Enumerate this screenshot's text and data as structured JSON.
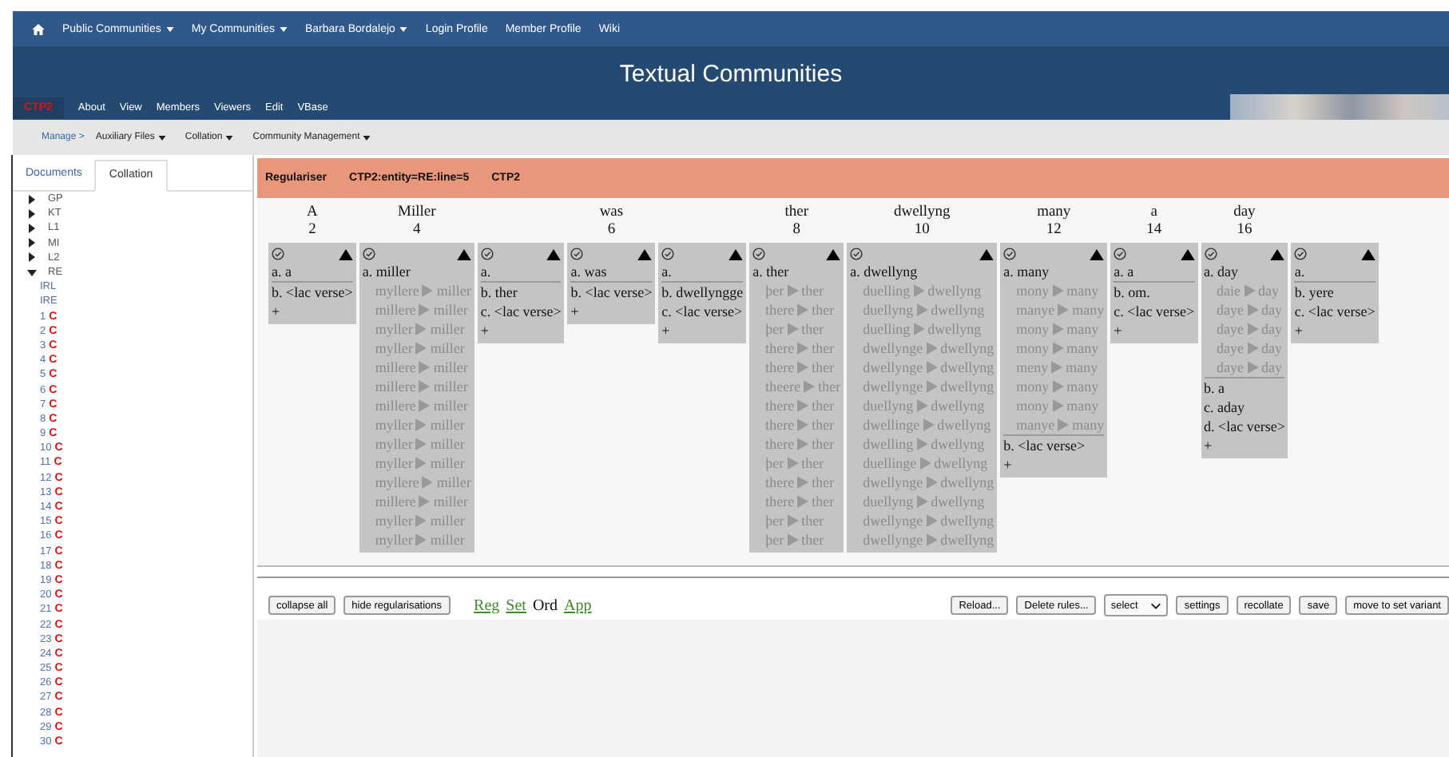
{
  "top_nav": {
    "items": [
      {
        "label": "Public Communities",
        "dropdown": true
      },
      {
        "label": "My Communities",
        "dropdown": true
      },
      {
        "label": "Barbara Bordalejo",
        "dropdown": true
      },
      {
        "label": "Login Profile",
        "dropdown": false
      },
      {
        "label": "Member Profile",
        "dropdown": false
      },
      {
        "label": "Wiki",
        "dropdown": false
      }
    ]
  },
  "header": {
    "title": "Textual Communities",
    "brand": "CTP2",
    "links": [
      "About",
      "View",
      "Members",
      "Viewers",
      "Edit",
      "VBase"
    ]
  },
  "manage_bar": {
    "label": "Manage >",
    "menus": [
      "Auxiliary Files",
      "Collation",
      "Community Management"
    ]
  },
  "sidebar": {
    "tabs": [
      {
        "label": "Documents",
        "selected": false
      },
      {
        "label": "Collation",
        "selected": true
      }
    ],
    "tree": [
      {
        "label": "GP",
        "expanded": false
      },
      {
        "label": "KT",
        "expanded": false
      },
      {
        "label": "L1",
        "expanded": false
      },
      {
        "label": "MI",
        "expanded": false
      },
      {
        "label": "L2",
        "expanded": false
      },
      {
        "label": "RE",
        "expanded": true,
        "children": [
          {
            "label": "IRL"
          },
          {
            "label": "IRE"
          },
          {
            "label": "1",
            "badge": "C"
          },
          {
            "label": "2",
            "badge": "C"
          },
          {
            "label": "3",
            "badge": "C"
          },
          {
            "label": "4",
            "badge": "C"
          },
          {
            "label": "5",
            "badge": "C"
          },
          {
            "label": "6",
            "badge": "C"
          },
          {
            "label": "7",
            "badge": "C"
          },
          {
            "label": "8",
            "badge": "C"
          },
          {
            "label": "9",
            "badge": "C"
          },
          {
            "label": "10",
            "badge": "C"
          },
          {
            "label": "11",
            "badge": "C"
          },
          {
            "label": "12",
            "badge": "C"
          },
          {
            "label": "13",
            "badge": "C"
          },
          {
            "label": "14",
            "badge": "C"
          },
          {
            "label": "15",
            "badge": "C"
          },
          {
            "label": "16",
            "badge": "C"
          },
          {
            "label": "17",
            "badge": "C"
          },
          {
            "label": "18",
            "badge": "C"
          },
          {
            "label": "19",
            "badge": "C"
          },
          {
            "label": "20",
            "badge": "C"
          },
          {
            "label": "21",
            "badge": "C"
          },
          {
            "label": "22",
            "badge": "C"
          },
          {
            "label": "23",
            "badge": "C"
          },
          {
            "label": "24",
            "badge": "C"
          },
          {
            "label": "25",
            "badge": "C"
          },
          {
            "label": "26",
            "badge": "C"
          },
          {
            "label": "27",
            "badge": "C"
          },
          {
            "label": "28",
            "badge": "C"
          },
          {
            "label": "29",
            "badge": "C"
          },
          {
            "label": "30",
            "badge": "C"
          }
        ]
      }
    ]
  },
  "regulariser": {
    "title": "Regulariser",
    "entity": "CTP2:entity=RE:line=5",
    "community": "CTP2",
    "columns": [
      {
        "word": "A",
        "number": "2",
        "variants": [
          {
            "label": "a. a"
          },
          {
            "label": "b. <lac verse>"
          }
        ],
        "add": "+"
      },
      {
        "word": "Miller",
        "number": "4",
        "variants": [
          {
            "label": "a. miller",
            "regularisations": [
              {
                "from": "myllere",
                "to": "miller"
              },
              {
                "from": "millere",
                "to": "miller"
              },
              {
                "from": "myller",
                "to": "miller"
              },
              {
                "from": "myller",
                "to": "miller"
              },
              {
                "from": "millere",
                "to": "miller"
              },
              {
                "from": "millere",
                "to": "miller"
              },
              {
                "from": "millere",
                "to": "miller"
              },
              {
                "from": "myller",
                "to": "miller"
              },
              {
                "from": "myller",
                "to": "miller"
              },
              {
                "from": "myller",
                "to": "miller"
              },
              {
                "from": "myllere",
                "to": "miller"
              },
              {
                "from": "millere",
                "to": "miller"
              },
              {
                "from": "myller",
                "to": "miller"
              },
              {
                "from": "myller",
                "to": "miller"
              }
            ]
          }
        ]
      },
      {
        "variants": [
          {
            "label": "a."
          },
          {
            "label": "b. ther"
          },
          {
            "label": "c. <lac verse>"
          }
        ],
        "add": "+"
      },
      {
        "word": "was",
        "number": "6",
        "variants": [
          {
            "label": "a. was"
          },
          {
            "label": "b. <lac verse>"
          }
        ],
        "add": "+"
      },
      {
        "variants": [
          {
            "label": "a."
          },
          {
            "label": "b. dwellyngge"
          },
          {
            "label": "c. <lac verse>"
          }
        ],
        "add": "+"
      },
      {
        "word": "ther",
        "number": "8",
        "variants": [
          {
            "label": "a. ther",
            "regularisations": [
              {
                "from": "þer",
                "to": "ther"
              },
              {
                "from": "there",
                "to": "ther"
              },
              {
                "from": "þer",
                "to": "ther"
              },
              {
                "from": "there",
                "to": "ther"
              },
              {
                "from": "there",
                "to": "ther"
              },
              {
                "from": "theere",
                "to": "ther"
              },
              {
                "from": "there",
                "to": "ther"
              },
              {
                "from": "there",
                "to": "ther"
              },
              {
                "from": "there",
                "to": "ther"
              },
              {
                "from": "þer",
                "to": "ther"
              },
              {
                "from": "there",
                "to": "ther"
              },
              {
                "from": "there",
                "to": "ther"
              },
              {
                "from": "þer",
                "to": "ther"
              },
              {
                "from": "þer",
                "to": "ther"
              }
            ]
          }
        ]
      },
      {
        "word": "dwellyng",
        "number": "10",
        "variants": [
          {
            "label": "a. dwellyng",
            "regularisations": [
              {
                "from": "duelling",
                "to": "dwellyng"
              },
              {
                "from": "duellyng",
                "to": "dwellyng"
              },
              {
                "from": "duelling",
                "to": "dwellyng"
              },
              {
                "from": "dwellynge",
                "to": "dwellyng"
              },
              {
                "from": "dwellynge",
                "to": "dwellyng"
              },
              {
                "from": "dwellynge",
                "to": "dwellyng"
              },
              {
                "from": "duellyng",
                "to": "dwellyng"
              },
              {
                "from": "dwellinge",
                "to": "dwellyng"
              },
              {
                "from": "dwelling",
                "to": "dwellyng"
              },
              {
                "from": "duellinge",
                "to": "dwellyng"
              },
              {
                "from": "dwellynge",
                "to": "dwellyng"
              },
              {
                "from": "duellyng",
                "to": "dwellyng"
              },
              {
                "from": "dwellynge",
                "to": "dwellyng"
              },
              {
                "from": "dwellynge",
                "to": "dwellyng"
              }
            ]
          }
        ]
      },
      {
        "word": "many",
        "number": "12",
        "variants": [
          {
            "label": "a. many",
            "regularisations": [
              {
                "from": "mony",
                "to": "many"
              },
              {
                "from": "manye",
                "to": "many"
              },
              {
                "from": "mony",
                "to": "many"
              },
              {
                "from": "mony",
                "to": "many"
              },
              {
                "from": "meny",
                "to": "many"
              },
              {
                "from": "mony",
                "to": "many"
              },
              {
                "from": "mony",
                "to": "many"
              },
              {
                "from": "manye",
                "to": "many"
              }
            ]
          },
          {
            "label": "b. <lac verse>"
          }
        ],
        "add": "+"
      },
      {
        "word": "a",
        "number": "14",
        "variants": [
          {
            "label": "a. a"
          },
          {
            "label": "b. om."
          },
          {
            "label": "c. <lac verse>"
          }
        ],
        "add": "+"
      },
      {
        "word": "day",
        "number": "16",
        "variants": [
          {
            "label": "a. day",
            "regularisations": [
              {
                "from": "daie",
                "to": "day"
              },
              {
                "from": "daye",
                "to": "day"
              },
              {
                "from": "daye",
                "to": "day"
              },
              {
                "from": "daye",
                "to": "day"
              },
              {
                "from": "daye",
                "to": "day"
              }
            ]
          },
          {
            "label": "b. a"
          },
          {
            "label": "c. aday"
          },
          {
            "label": "d. <lac verse>"
          }
        ],
        "add": "+"
      },
      {
        "variants": [
          {
            "label": "a."
          },
          {
            "label": "b. yere"
          },
          {
            "label": "c. <lac verse>"
          }
        ],
        "add": "+"
      }
    ]
  },
  "toolbar": {
    "left_buttons": [
      "collapse all",
      "hide regularisations"
    ],
    "view_modes": [
      {
        "label": "Reg",
        "selected": false
      },
      {
        "label": "Set",
        "selected": false
      },
      {
        "label": "Ord",
        "selected": true
      },
      {
        "label": "App",
        "selected": false
      }
    ],
    "right_buttons": [
      "Reload...",
      "Delete rules..."
    ],
    "select": {
      "value": "select"
    },
    "action_buttons": [
      "settings",
      "recollate",
      "save",
      "move to set variant"
    ]
  }
}
